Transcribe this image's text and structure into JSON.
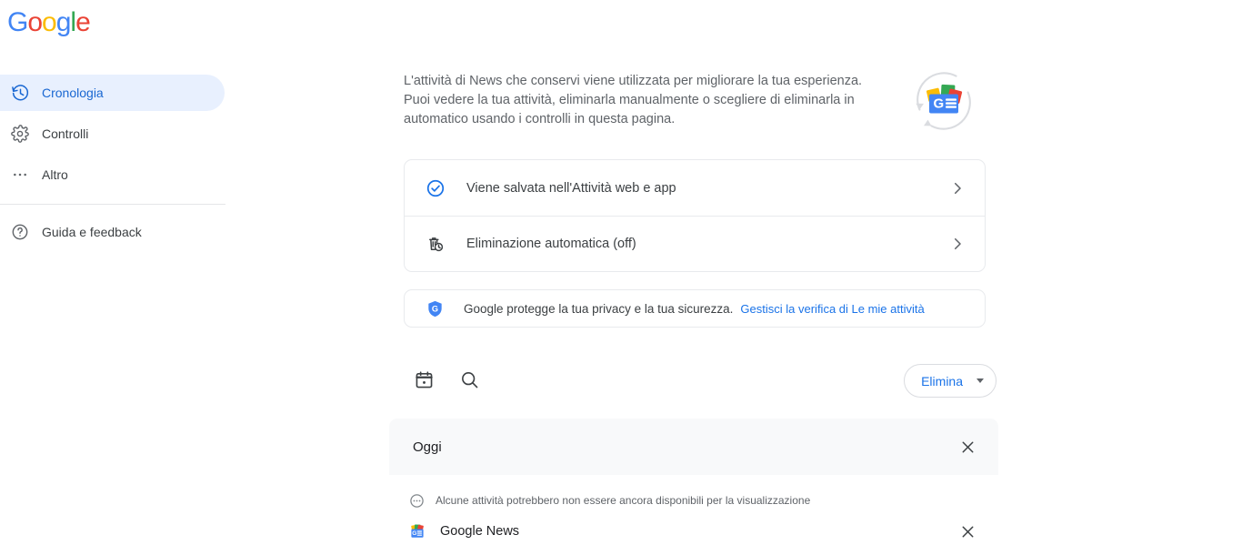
{
  "brand": {
    "logo_text": "Google",
    "logo_letters": [
      {
        "c": "G",
        "color": "#4285f4"
      },
      {
        "c": "o",
        "color": "#ea4335"
      },
      {
        "c": "o",
        "color": "#fbbc05"
      },
      {
        "c": "g",
        "color": "#4285f4"
      },
      {
        "c": "l",
        "color": "#34a853"
      },
      {
        "c": "e",
        "color": "#ea4335"
      }
    ],
    "colors": {
      "blue": "#4285f4",
      "red": "#ea4335",
      "yellow": "#fbbc05",
      "green": "#34a853",
      "link": "#1a73e8",
      "active_nav": "#1967d2",
      "active_nav_bg": "#e8f0fe"
    }
  },
  "sidebar": {
    "items": [
      {
        "label": "Cronologia",
        "icon": "history-icon",
        "active": true
      },
      {
        "label": "Controlli",
        "icon": "gear-icon",
        "active": false
      },
      {
        "label": "Altro",
        "icon": "more-horizontal-icon",
        "active": false
      }
    ],
    "bottom_items": [
      {
        "label": "Guida e feedback",
        "icon": "help-circle-icon"
      }
    ]
  },
  "main": {
    "intro_paragraph": "L'attività di News che conservi viene utilizzata per migliorare la tua esperienza. Puoi vedere la tua attività, eliminarla manualmente o scegliere di eliminarla in automatico usando i controlli in questa pagina.",
    "hero_icon": "google-news-autodelete-illustration",
    "activity_controls": [
      {
        "label": "Viene salvata nell'Attività web e app",
        "icon": "check-circle-icon",
        "chevron": "chevron-right-icon"
      },
      {
        "label": "Eliminazione automatica (off)",
        "icon": "auto-delete-icon",
        "chevron": "chevron-right-icon"
      }
    ],
    "privacy": {
      "icon": "google-shield-icon",
      "text": "Google protegge la tua privacy e la tua sicurezza.",
      "link_text": "Gestisci la verifica di Le mie attività"
    },
    "toolbar": {
      "calendar_icon": "calendar-icon",
      "search_icon": "search-icon",
      "delete_button_label": "Elimina",
      "delete_caret_icon": "caret-down-icon"
    },
    "day_group": {
      "title": "Oggi",
      "close_icon": "close-icon",
      "pending_notice": {
        "icon": "pending-dots-icon",
        "text": "Alcune attività potrebbero non essere ancora disponibili per la visualizzazione"
      },
      "items": [
        {
          "title": "Google News",
          "icon": "google-news-icon",
          "close_icon": "close-icon"
        }
      ]
    }
  }
}
